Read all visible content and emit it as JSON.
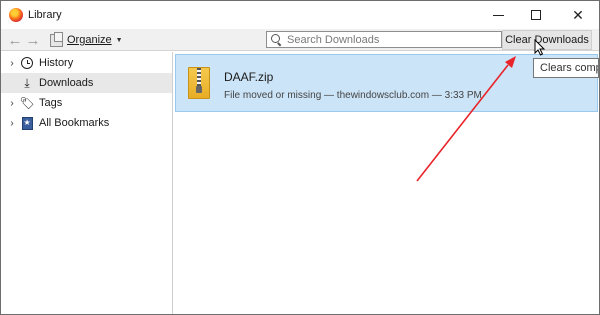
{
  "window": {
    "title": "Library",
    "icon": "firefox-icon"
  },
  "toolbar": {
    "back_icon": "back-arrow-icon",
    "forward_icon": "forward-arrow-icon",
    "organize_label": "Organize",
    "search": {
      "placeholder": "Search Downloads",
      "value": ""
    },
    "clear_label": "Clear Downloads"
  },
  "sidebar": {
    "items": [
      {
        "label": "History",
        "icon": "clock-icon",
        "expandable": true
      },
      {
        "label": "Downloads",
        "icon": "download-icon",
        "expandable": false,
        "selected": true
      },
      {
        "label": "Tags",
        "icon": "tag-icon",
        "expandable": true
      },
      {
        "label": "All Bookmarks",
        "icon": "bookmarks-icon",
        "expandable": true
      }
    ]
  },
  "downloads": [
    {
      "name": "DAAF.zip",
      "status": "File moved or missing — thewindowsclub.com — 3:33 PM",
      "icon": "zip-file-icon"
    }
  ],
  "tooltip": {
    "text": "Clears compl"
  },
  "colors": {
    "selected_row": "#cce4f7",
    "annotation_arrow": "#e8242a"
  }
}
